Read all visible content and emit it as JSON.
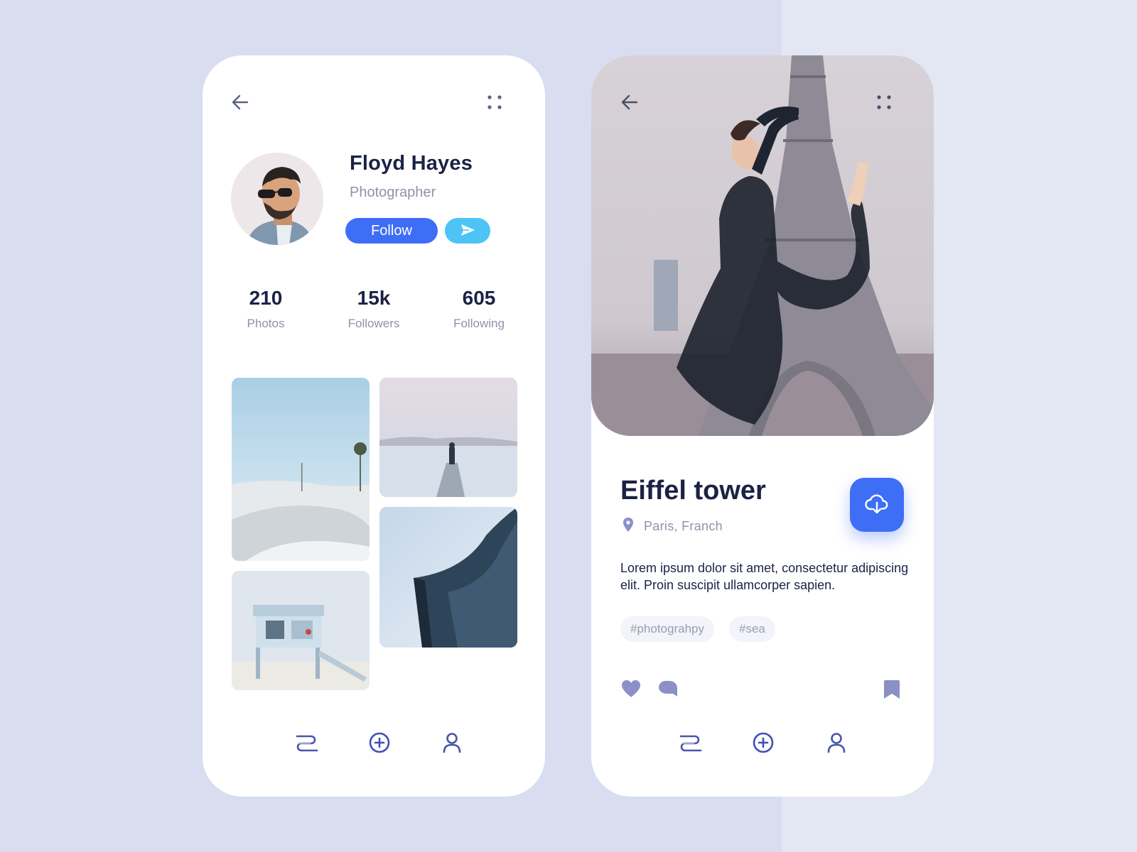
{
  "colors": {
    "background": "#d8ddef",
    "accent": "#3e6ef6",
    "send": "#4dc4f5",
    "text_dark": "#1b2245",
    "text_muted": "#8e92aa",
    "icon": "#8b90c6"
  },
  "profile_screen": {
    "icons": {
      "back": "arrow-left-icon",
      "menu": "four-dots-icon"
    },
    "name": "Floyd Hayes",
    "role": "Photographer",
    "follow_label": "Follow",
    "stats": [
      {
        "value": "210",
        "label": "Photos"
      },
      {
        "value": "15k",
        "label": "Followers"
      },
      {
        "value": "605",
        "label": "Following"
      }
    ],
    "tabbar": [
      "feed-icon",
      "add-circle-icon",
      "user-icon"
    ]
  },
  "detail_screen": {
    "icons": {
      "back": "arrow-left-icon",
      "menu": "four-dots-icon"
    },
    "title": "Eiffel tower",
    "location": "Paris, Franch",
    "description": "Lorem ipsum dolor sit amet, consectetur adipiscing elit. Proin suscipit ullamcorper sapien.",
    "tags": [
      "#photograhpy",
      "#sea"
    ],
    "actions": [
      "heart-icon",
      "comment-icon",
      "bookmark-icon"
    ],
    "tabbar": [
      "feed-icon",
      "add-circle-icon",
      "user-icon"
    ]
  }
}
